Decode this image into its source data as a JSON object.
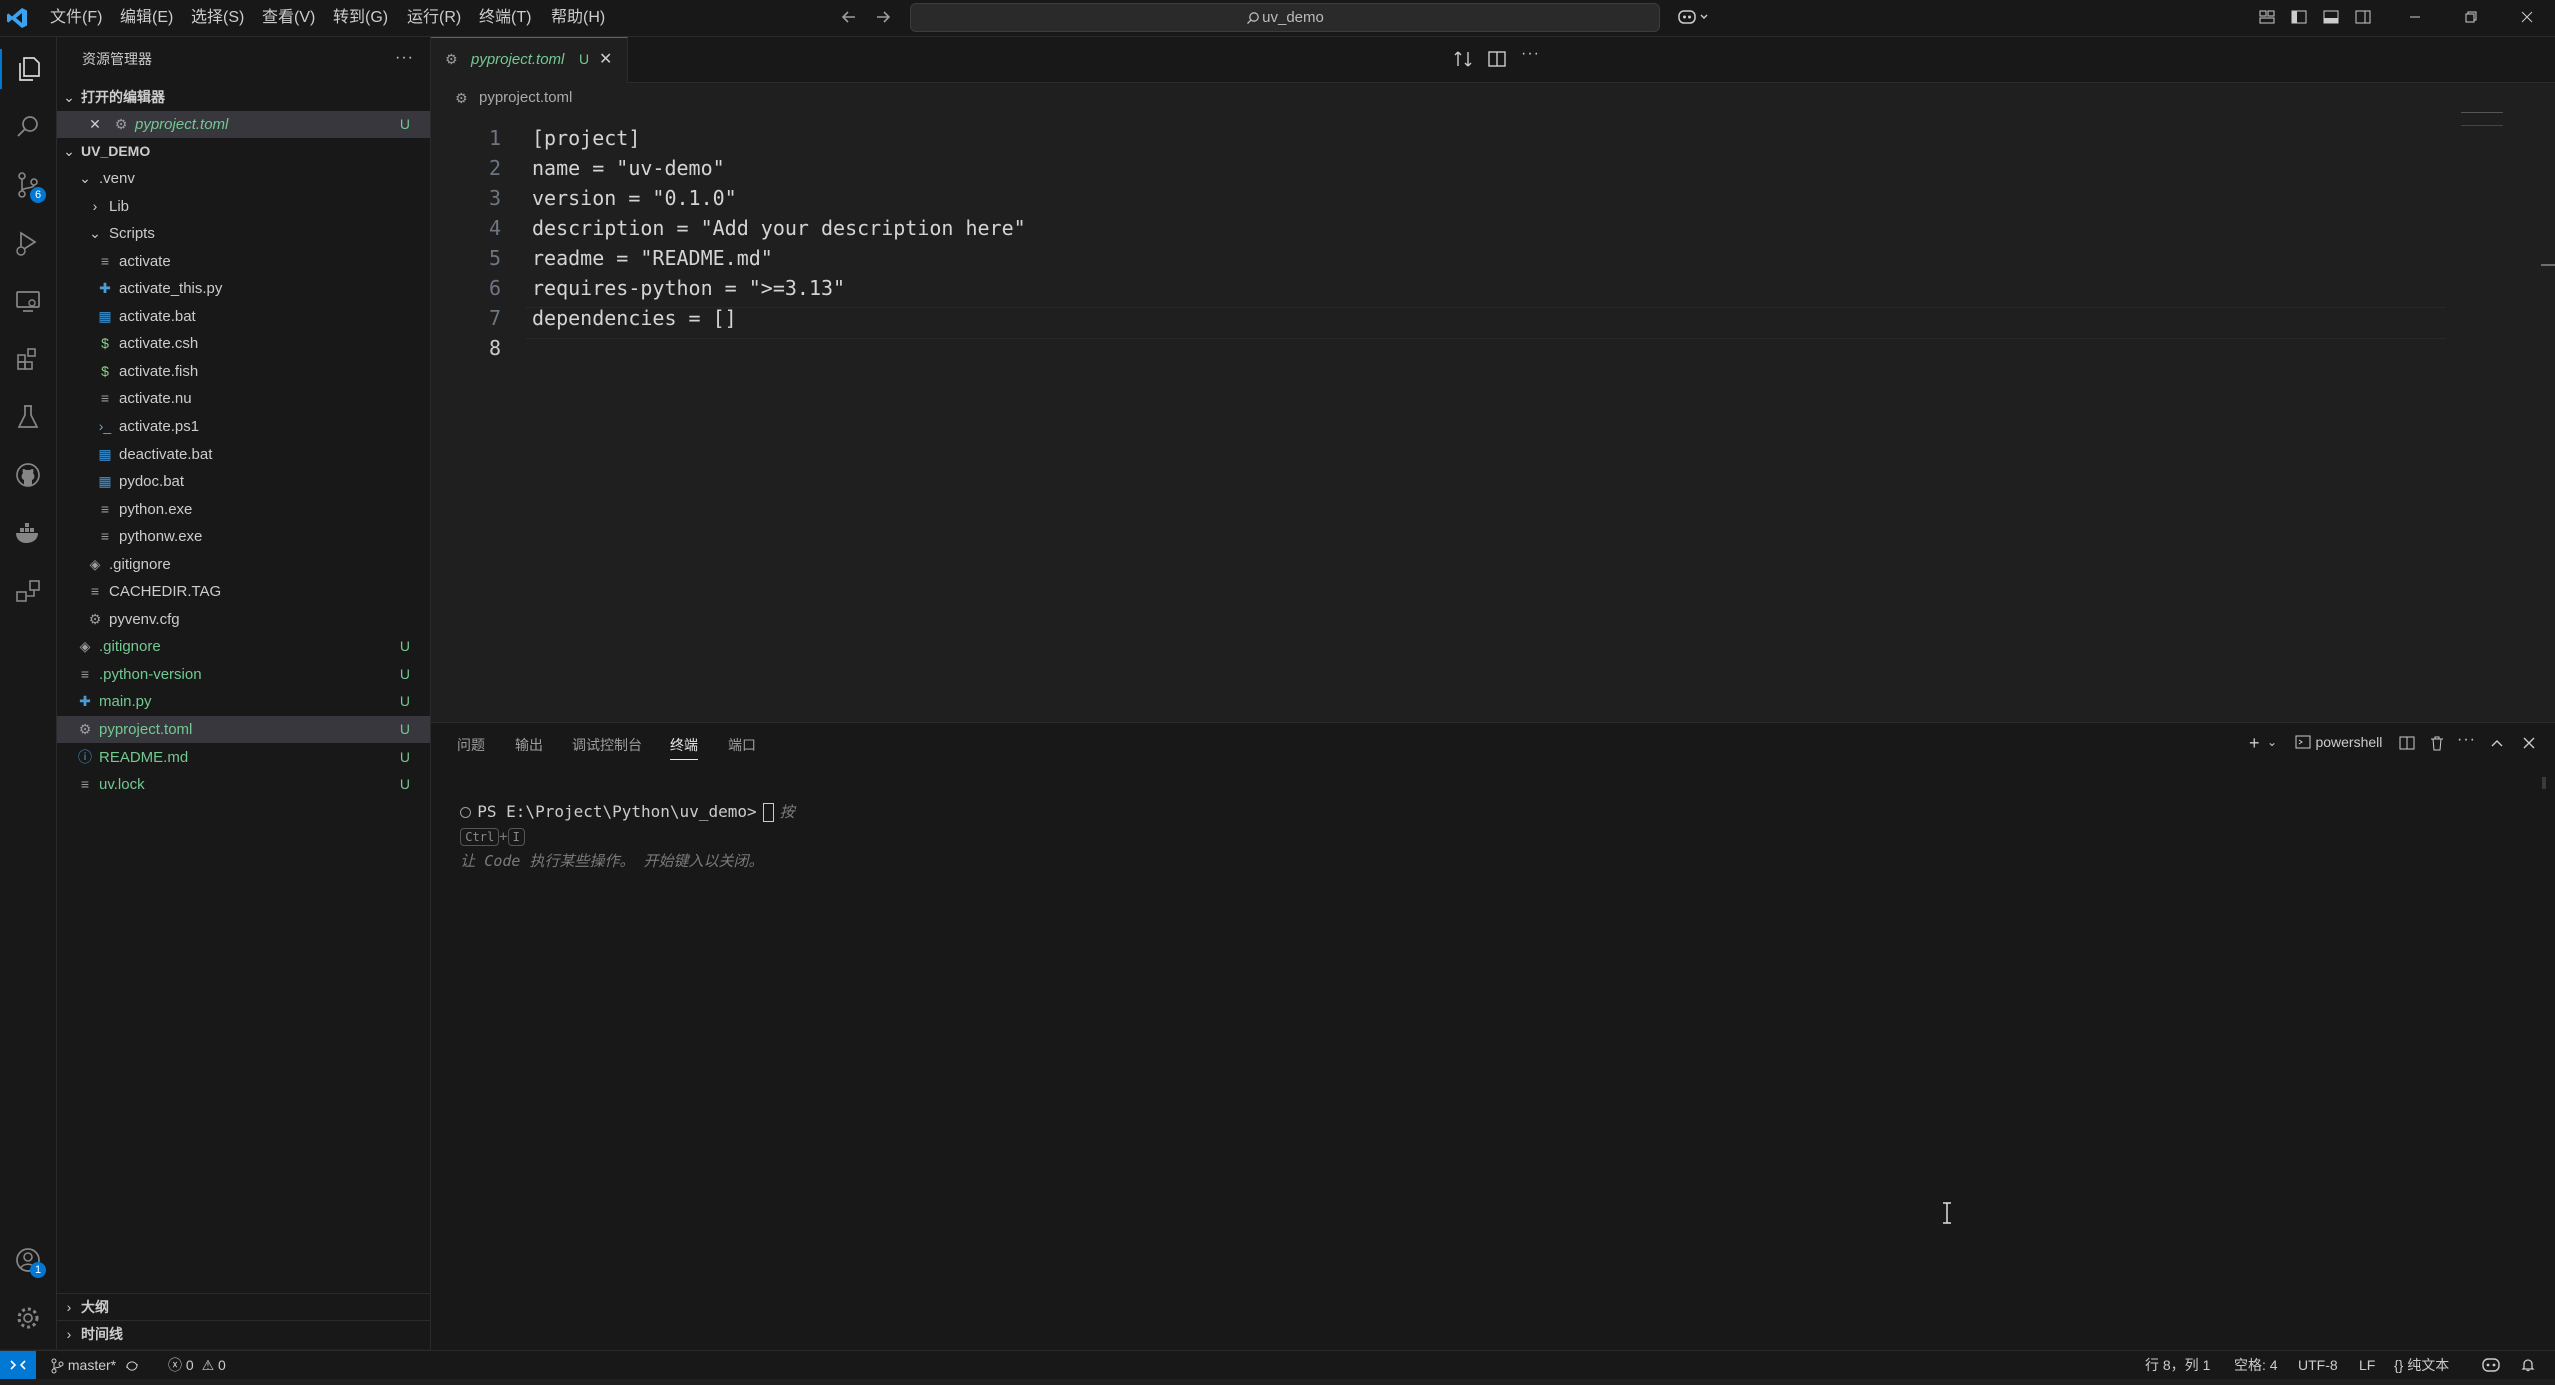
{
  "titlebar": {
    "menus": [
      "文件(F)",
      "编辑(E)",
      "选择(S)",
      "查看(V)",
      "转到(G)",
      "运行(R)",
      "终端(T)",
      "帮助(H)"
    ],
    "search_text": "uv_demo"
  },
  "activitybar": {
    "scm_badge": "6",
    "accounts_badge": "1"
  },
  "sidebar": {
    "title": "资源管理器",
    "open_editors_header": "打开的编辑器",
    "open_editor_file": "pyproject.toml",
    "open_editor_status": "U",
    "workspace_header": "UV_DEMO",
    "tree": [
      {
        "label": ".venv",
        "kind": "folder-open",
        "depth": 1
      },
      {
        "label": "Lib",
        "kind": "folder",
        "depth": 2
      },
      {
        "label": "Scripts",
        "kind": "folder-open",
        "depth": 2
      },
      {
        "label": "activate",
        "kind": "lines",
        "depth": 3
      },
      {
        "label": "activate_this.py",
        "kind": "python",
        "depth": 3
      },
      {
        "label": "activate.bat",
        "kind": "windows",
        "depth": 3
      },
      {
        "label": "activate.csh",
        "kind": "shell",
        "depth": 3
      },
      {
        "label": "activate.fish",
        "kind": "shell",
        "depth": 3
      },
      {
        "label": "activate.nu",
        "kind": "lines",
        "depth": 3
      },
      {
        "label": "activate.ps1",
        "kind": "powershell",
        "depth": 3
      },
      {
        "label": "deactivate.bat",
        "kind": "windows",
        "depth": 3
      },
      {
        "label": "pydoc.bat",
        "kind": "windows",
        "depth": 3
      },
      {
        "label": "python.exe",
        "kind": "lines",
        "depth": 3
      },
      {
        "label": "pythonw.exe",
        "kind": "lines",
        "depth": 3
      },
      {
        "label": ".gitignore",
        "kind": "git",
        "depth": 2
      },
      {
        "label": "CACHEDIR.TAG",
        "kind": "lines",
        "depth": 2
      },
      {
        "label": "pyvenv.cfg",
        "kind": "gear",
        "depth": 2
      },
      {
        "label": ".gitignore",
        "kind": "git",
        "depth": 1,
        "status": "U"
      },
      {
        "label": ".python-version",
        "kind": "lines",
        "depth": 1,
        "status": "U"
      },
      {
        "label": "main.py",
        "kind": "python",
        "depth": 1,
        "status": "U"
      },
      {
        "label": "pyproject.toml",
        "kind": "gear",
        "depth": 1,
        "status": "U",
        "selected": true
      },
      {
        "label": "README.md",
        "kind": "info",
        "depth": 1,
        "status": "U"
      },
      {
        "label": "uv.lock",
        "kind": "lines",
        "depth": 1,
        "status": "U"
      }
    ],
    "outline_header": "大纲",
    "timeline_header": "时间线"
  },
  "editor": {
    "tab_label": "pyproject.toml",
    "tab_status": "U",
    "breadcrumb": "pyproject.toml",
    "lines": [
      "[project]",
      "name = \"uv-demo\"",
      "version = \"0.1.0\"",
      "description = \"Add your description here\"",
      "readme = \"README.md\"",
      "requires-python = \">=3.13\"",
      "dependencies = []",
      ""
    ],
    "line_numbers": [
      "1",
      "2",
      "3",
      "4",
      "5",
      "6",
      "7",
      "8"
    ]
  },
  "panel": {
    "tabs": [
      "问题",
      "输出",
      "调试控制台",
      "终端",
      "端口"
    ],
    "active_tab": "终端",
    "shell_name": "powershell",
    "prompt": "PS E:\\Project\\Python\\uv_demo>",
    "hint_prefix": "按",
    "hint_key1": "Ctrl",
    "hint_plus": "+",
    "hint_key2": "I",
    "hint_suffix": "让 Code 执行某些操作。 开始键入以关闭。"
  },
  "statusbar": {
    "branch": "master*",
    "errors": "0",
    "warnings": "0",
    "position": "行 8，列 1",
    "spaces": "空格: 4",
    "encoding": "UTF-8",
    "eol": "LF",
    "language": "{} 纯文本"
  },
  "colors": {
    "accent": "#0078d4",
    "untracked": "#73c991",
    "background": "#1f1f1f"
  }
}
